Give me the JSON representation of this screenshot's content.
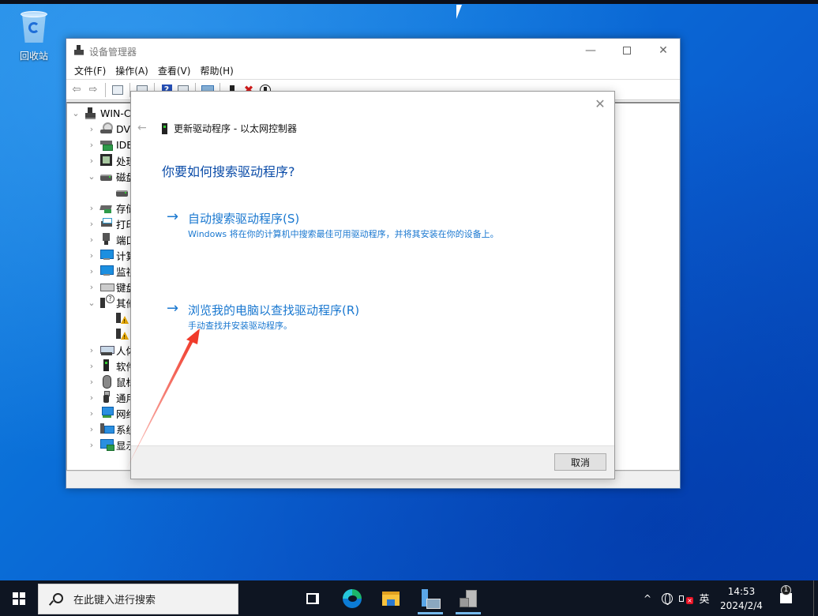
{
  "desktop": {
    "recycle_bin_label": "回收站"
  },
  "main_window": {
    "title": "设备管理器",
    "controls": {
      "minimize": "—",
      "maximize": "",
      "close": "✕"
    },
    "menu": [
      "文件(F)",
      "操作(A)",
      "查看(V)",
      "帮助(H)"
    ],
    "toolbar": [
      "back",
      "forward",
      "show-hide-console-tree",
      "properties",
      "help",
      "action-pane",
      "scan-hardware",
      "update-driver",
      "uninstall-device",
      "enable-device"
    ],
    "tree": {
      "root": "WIN-C",
      "items": [
        {
          "label": "DVD",
          "icon": "dvd-drive-icon",
          "expanded": false,
          "level": 1
        },
        {
          "label": "IDE",
          "icon": "ide-controller-icon",
          "expanded": false,
          "level": 1
        },
        {
          "label": "处理",
          "icon": "processor-icon",
          "expanded": false,
          "level": 1
        },
        {
          "label": "磁盘",
          "icon": "disk-drive-icon",
          "expanded": true,
          "level": 1
        },
        {
          "label": "",
          "icon": "disk-drive-icon",
          "expanded": null,
          "level": 2
        },
        {
          "label": "存储",
          "icon": "storage-controller-icon",
          "expanded": false,
          "level": 1
        },
        {
          "label": "打印",
          "icon": "printer-icon",
          "expanded": false,
          "level": 1
        },
        {
          "label": "端口",
          "icon": "port-icon",
          "expanded": false,
          "level": 1
        },
        {
          "label": "计算",
          "icon": "computer-icon",
          "expanded": false,
          "level": 1
        },
        {
          "label": "监视",
          "icon": "monitor-icon",
          "expanded": false,
          "level": 1
        },
        {
          "label": "键盘",
          "icon": "keyboard-icon",
          "expanded": false,
          "level": 1
        },
        {
          "label": "其他",
          "icon": "other-devices-icon",
          "expanded": true,
          "level": 1
        },
        {
          "label": "",
          "icon": "warning-device-icon",
          "expanded": null,
          "level": 2
        },
        {
          "label": "",
          "icon": "warning-device-icon",
          "expanded": null,
          "level": 2
        },
        {
          "label": "人体",
          "icon": "hid-icon",
          "expanded": false,
          "level": 1
        },
        {
          "label": "软件",
          "icon": "software-device-icon",
          "expanded": false,
          "level": 1
        },
        {
          "label": "鼠标",
          "icon": "mouse-icon",
          "expanded": false,
          "level": 1
        },
        {
          "label": "通用",
          "icon": "usb-icon",
          "expanded": false,
          "level": 1
        },
        {
          "label": "网络",
          "icon": "network-adapter-icon",
          "expanded": false,
          "level": 1
        },
        {
          "label": "系统",
          "icon": "system-device-icon",
          "expanded": false,
          "level": 1
        },
        {
          "label": "显示",
          "icon": "display-adapter-icon",
          "expanded": false,
          "level": 1
        }
      ]
    }
  },
  "dialog": {
    "header": "更新驱动程序 - 以太网控制器",
    "question": "你要如何搜索驱动程序?",
    "options": [
      {
        "title": "自动搜索驱动程序(S)",
        "description": "Windows 将在你的计算机中搜索最佳可用驱动程序，并将其安装在你的设备上。"
      },
      {
        "title": "浏览我的电脑以查找驱动程序(R)",
        "description": "手动查找并安装驱动程序。"
      }
    ],
    "arrow_glyph": "→",
    "cancel_label": "取消",
    "close_glyph": "✕",
    "back_glyph": "←"
  },
  "annotation": {
    "type": "arrow",
    "color": "#f03a2a",
    "points_to": "浏览我的电脑以查找驱动程序(R)"
  },
  "taskbar": {
    "search_placeholder": "在此键入进行搜索",
    "apps": [
      "task-view",
      "edge",
      "file-explorer",
      "server-manager",
      "device-manager"
    ],
    "tray": {
      "chevron": "^",
      "ime": "英",
      "time": "14:53",
      "date": "2024/2/4",
      "notification_count": "1"
    }
  }
}
